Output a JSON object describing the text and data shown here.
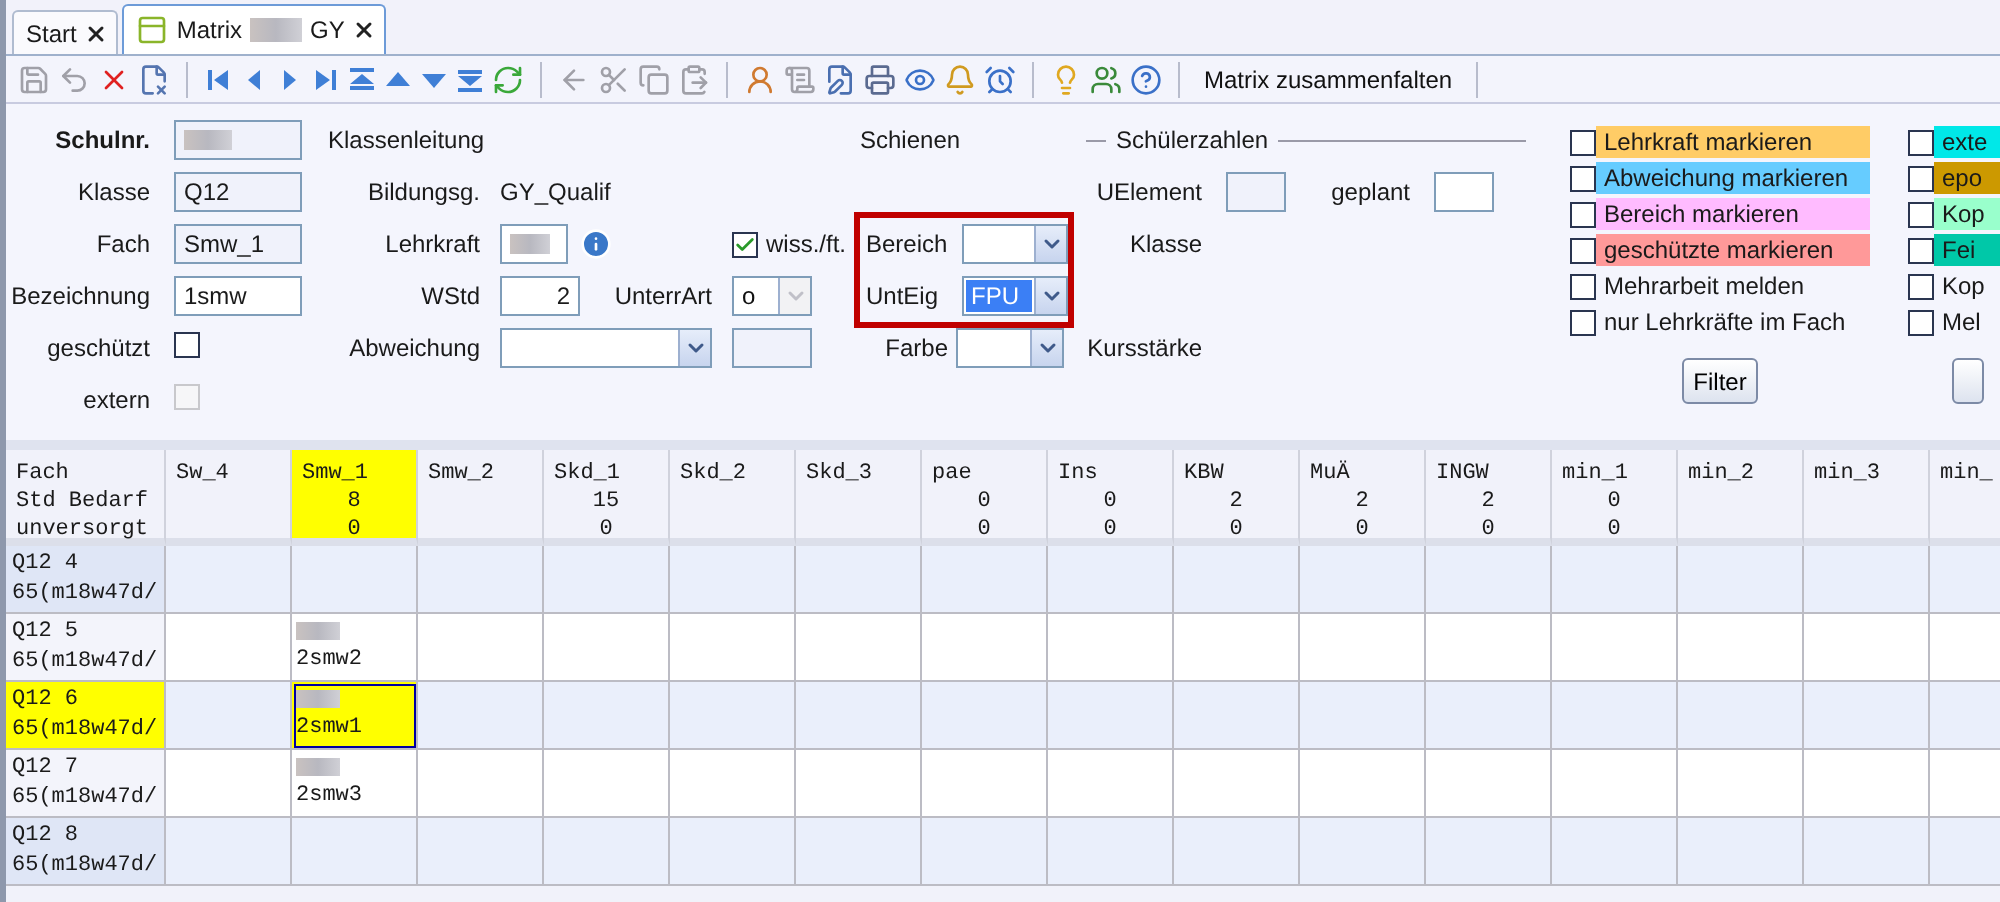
{
  "tabs": [
    {
      "label": "Start",
      "selected": false
    },
    {
      "label": "Matrix",
      "suffix": "GY",
      "selected": true
    }
  ],
  "toolbar": {
    "button": "Matrix zusammenfalten"
  },
  "form": {
    "left": [
      {
        "label": "Schulnr.",
        "kind": "text",
        "bold": true,
        "readonly": true,
        "redacted": true
      },
      {
        "label": "Klasse",
        "kind": "text",
        "value": "Q12",
        "readonly": true
      },
      {
        "label": "Fach",
        "kind": "text",
        "value": "Smw_1",
        "readonly": true
      },
      {
        "label": "Bezeichnung",
        "kind": "text",
        "value": "1smw",
        "readonly": false
      },
      {
        "label": "geschützt",
        "kind": "checkbox",
        "checked": false,
        "disabled": false
      },
      {
        "label": "extern",
        "kind": "checkbox",
        "checked": false,
        "disabled": true
      }
    ],
    "klassenleitung": "Klassenleitung",
    "bildungsgang": {
      "label": "Bildungsg.",
      "value": "GY_Qualif"
    },
    "lehrkraft": {
      "label": "Lehrkraft"
    },
    "wiss": {
      "label": "wiss./ft.",
      "checked": true
    },
    "wstd": {
      "label": "WStd",
      "value": "2"
    },
    "unterrart": {
      "label": "UnterrArt",
      "value": "o",
      "disabled": true
    },
    "abweichung": {
      "label": "Abweichung"
    },
    "schienen": {
      "title": "Schienen",
      "highlighted": true,
      "bereich": {
        "label": "Bereich"
      },
      "unteig": {
        "label": "UntEig",
        "value": "FPU",
        "focused": true
      },
      "farbe": {
        "label": "Farbe"
      }
    },
    "schuelerzahlen": {
      "title": "Schülerzahlen",
      "uelement": "UElement",
      "geplant": "geplant",
      "klasse": "Klasse",
      "kursstaerke": "Kursstärke"
    },
    "markers": [
      {
        "label": "Lehrkraft markieren",
        "color": "#ffcc66",
        "checked": false
      },
      {
        "label": "Abweichung markieren",
        "color": "#66ccff",
        "checked": false
      },
      {
        "label": "Bereich markieren",
        "color": "#ffbbff",
        "checked": false
      },
      {
        "label": "geschützte markieren",
        "color": "#ff9999",
        "checked": false
      },
      {
        "label": "Mehrarbeit melden",
        "checked": false
      },
      {
        "label": "nur Lehrkräfte im Fach",
        "checked": false
      }
    ],
    "filter_button": "Filter",
    "markers_2": [
      {
        "label": "exte",
        "color": "#00e8e8",
        "checked": false
      },
      {
        "label": "epo",
        "color": "#cc9900",
        "checked": false
      },
      {
        "label": "Kop",
        "color": "#99ffcc",
        "checked": false
      },
      {
        "label": "Fei",
        "color": "#00c8a8",
        "checked": false
      },
      {
        "label": "Kop",
        "checked": false
      },
      {
        "label": "Mel",
        "checked": false
      }
    ]
  },
  "matrix": {
    "header_labels": [
      "Fach",
      "Std Bedarf",
      "unversorgt"
    ],
    "columns": [
      {
        "name": "Sw_4",
        "selected": false
      },
      {
        "name": "Smw_1",
        "bedarf": "8",
        "unversorgt": "0",
        "selected": true
      },
      {
        "name": "Smw_2",
        "selected": false
      },
      {
        "name": "Skd_1",
        "bedarf": "15",
        "unversorgt": "0",
        "selected": false
      },
      {
        "name": "Skd_2",
        "selected": false
      },
      {
        "name": "Skd_3",
        "selected": false
      },
      {
        "name": "pae",
        "bedarf": "0",
        "unversorgt": "0",
        "selected": false
      },
      {
        "name": "Ins",
        "bedarf": "0",
        "unversorgt": "0",
        "selected": false
      },
      {
        "name": "KBW",
        "bedarf": "2",
        "unversorgt": "0",
        "selected": false
      },
      {
        "name": "MuÄ",
        "bedarf": "2",
        "unversorgt": "0",
        "selected": false
      },
      {
        "name": "INGW",
        "bedarf": "2",
        "unversorgt": "0",
        "selected": false
      },
      {
        "name": "min_1",
        "bedarf": "0",
        "unversorgt": "0",
        "selected": false
      },
      {
        "name": "min_2",
        "selected": false
      },
      {
        "name": "min_3",
        "selected": false
      },
      {
        "name": "min_",
        "selected": false
      }
    ],
    "rows": [
      {
        "klasse": "Q12 4",
        "info": "65(m18w47d/",
        "selected": false
      },
      {
        "klasse": "Q12 5",
        "info": "65(m18w47d/",
        "selected": false,
        "cells": [
          {
            "kind": "empty"
          },
          {
            "kind": "entry",
            "text": "2smw2",
            "selected": false
          }
        ]
      },
      {
        "klasse": "Q12 6",
        "info": "65(m18w47d/",
        "selected": true,
        "cells": [
          {
            "kind": "empty"
          },
          {
            "kind": "entry",
            "text": "2smw1",
            "selected": true
          }
        ]
      },
      {
        "klasse": "Q12 7",
        "info": "65(m18w47d/",
        "selected": false,
        "cells": [
          {
            "kind": "empty"
          },
          {
            "kind": "entry",
            "text": "2smw3",
            "selected": false
          }
        ]
      },
      {
        "klasse": "Q12 8",
        "info": "65(m18w47d/",
        "selected": false
      }
    ]
  }
}
